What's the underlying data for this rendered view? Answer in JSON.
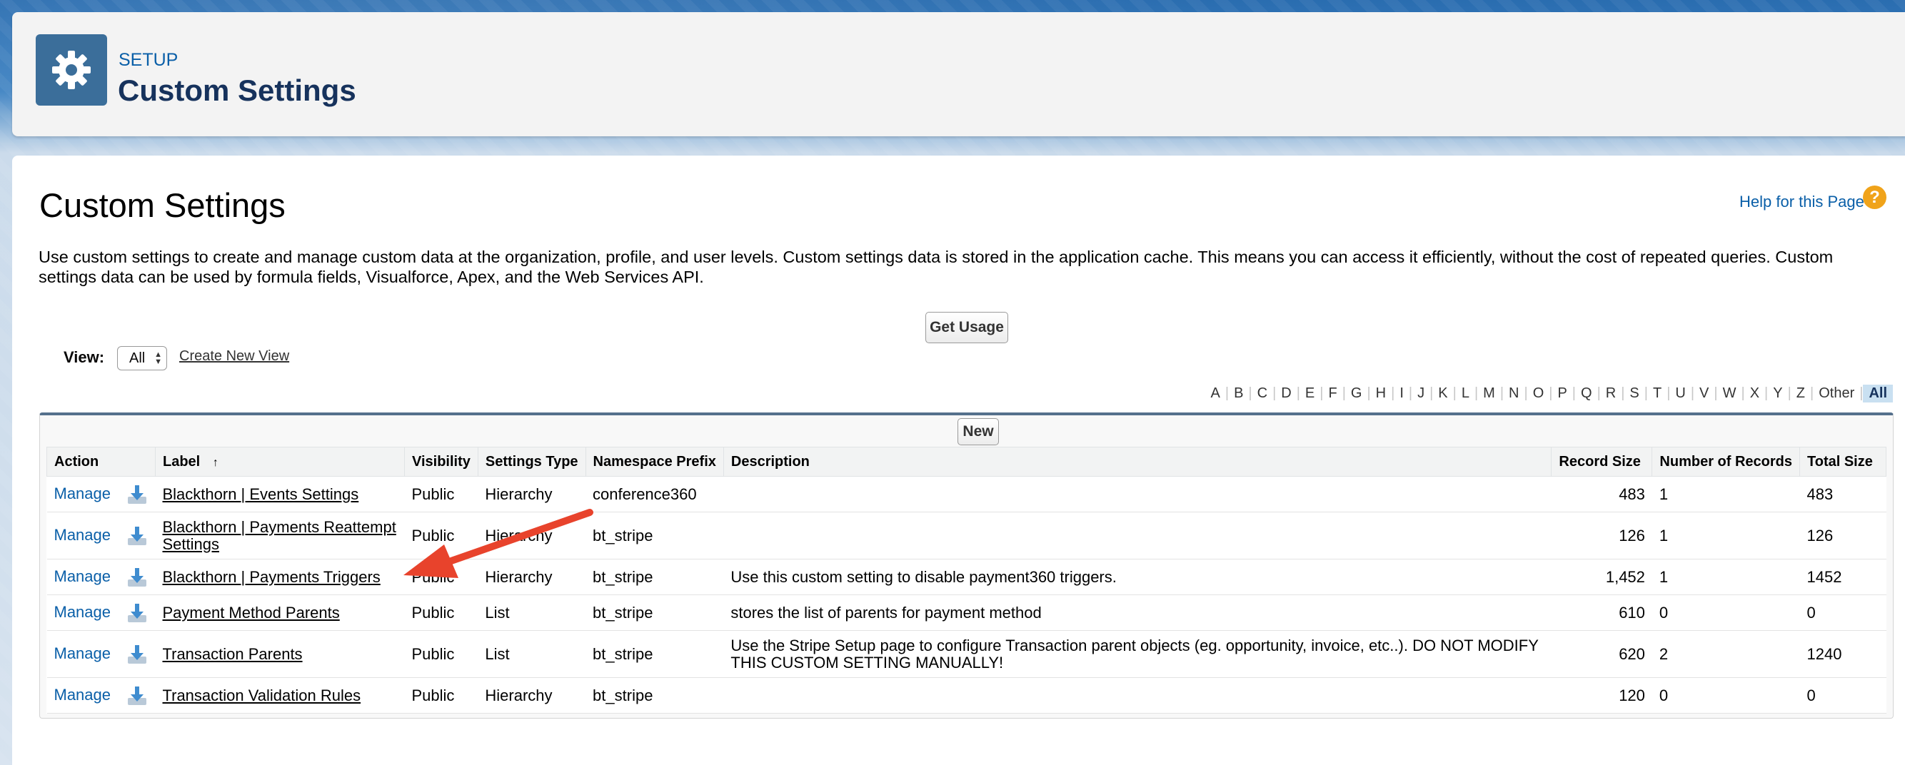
{
  "header": {
    "breadcrumb": "SETUP",
    "title": "Custom Settings"
  },
  "page": {
    "title": "Custom Settings",
    "help_link": "Help for this Page",
    "help_icon": "?",
    "description": "Use custom settings to create and manage custom data at the organization, profile, and user levels. Custom settings data is stored in the application cache. This means you can access it efficiently, without the cost of repeated queries. Custom settings data can be used by formula fields, Visualforce, Apex, and the Web Services API.",
    "get_usage_label": "Get Usage"
  },
  "view": {
    "label": "View:",
    "selected": "All",
    "create_new_view": "Create New View"
  },
  "alphabet": [
    "A",
    "B",
    "C",
    "D",
    "E",
    "F",
    "G",
    "H",
    "I",
    "J",
    "K",
    "L",
    "M",
    "N",
    "O",
    "P",
    "Q",
    "R",
    "S",
    "T",
    "U",
    "V",
    "W",
    "X",
    "Y",
    "Z",
    "Other",
    "All"
  ],
  "alphabet_active": "All",
  "list": {
    "new_label": "New",
    "columns": [
      "Action",
      "Label",
      "Visibility",
      "Settings Type",
      "Namespace Prefix",
      "Description",
      "Record Size",
      "Number of Records",
      "Total Size"
    ],
    "sort_indicator": "↑",
    "rows": [
      {
        "action": "Manage",
        "label": "Blackthorn | Events Settings",
        "visibility": "Public",
        "type": "Hierarchy",
        "ns": "conference360",
        "description": "",
        "record_size": "483",
        "num_records": "1",
        "total_size": "483"
      },
      {
        "action": "Manage",
        "label": "Blackthorn | Payments Reattempt Settings",
        "visibility": "Public",
        "type": "Hierarchy",
        "ns": "bt_stripe",
        "description": "",
        "record_size": "126",
        "num_records": "1",
        "total_size": "126"
      },
      {
        "action": "Manage",
        "label": "Blackthorn | Payments Triggers",
        "visibility": "Public",
        "type": "Hierarchy",
        "ns": "bt_stripe",
        "description": "Use this custom setting to disable payment360 triggers.",
        "record_size": "1,452",
        "num_records": "1",
        "total_size": "1452"
      },
      {
        "action": "Manage",
        "label": "Payment Method Parents",
        "visibility": "Public",
        "type": "List",
        "ns": "bt_stripe",
        "description": "stores the list of parents for payment method",
        "record_size": "610",
        "num_records": "0",
        "total_size": "0"
      },
      {
        "action": "Manage",
        "label": "Transaction Parents",
        "visibility": "Public",
        "type": "List",
        "ns": "bt_stripe",
        "description": "Use the Stripe Setup page to configure Transaction parent objects (eg. opportunity, invoice, etc..). DO NOT MODIFY THIS CUSTOM SETTING MANUALLY!",
        "record_size": "620",
        "num_records": "2",
        "total_size": "1240"
      },
      {
        "action": "Manage",
        "label": "Transaction Validation Rules",
        "visibility": "Public",
        "type": "Hierarchy",
        "ns": "bt_stripe",
        "description": "",
        "record_size": "120",
        "num_records": "0",
        "total_size": "0"
      }
    ]
  },
  "icons": {
    "header": "gear-icon",
    "row": "download-icon",
    "annotation": "red-arrow-annotation"
  },
  "colors": {
    "link": "#0a5fa8",
    "header_icon_bg": "#3b6e9a",
    "annotation_arrow": "#e8432c"
  }
}
